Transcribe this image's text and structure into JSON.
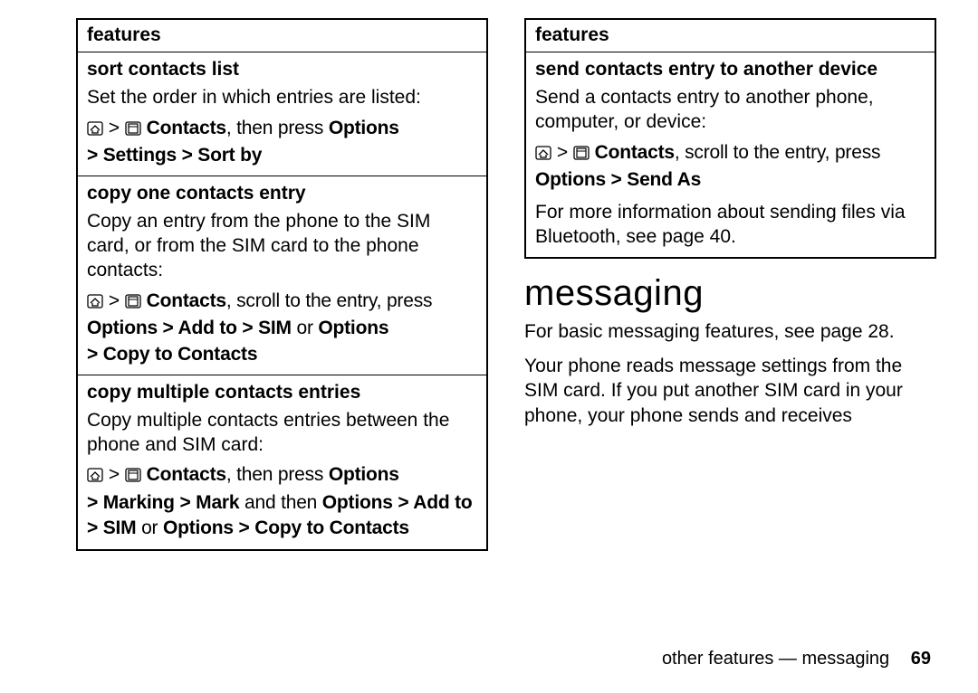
{
  "left": {
    "header": "features",
    "r1": {
      "title": "sort contacts list",
      "desc": "Set the order in which entries are listed:",
      "nav1_app": "Contacts",
      "nav1_mid": ", then press ",
      "nav1_opt": "Options",
      "nav2": "> Settings > Sort by"
    },
    "r2": {
      "title": "copy one contacts entry",
      "desc": "Copy an entry from the phone to the SIM card, or from the SIM card to the phone contacts:",
      "nav1_app": "Contacts",
      "nav1_mid": ", scroll to the entry, press ",
      "nav2a": "Options > Add to > SIM",
      "nav2_or": " or ",
      "nav2b": "Options",
      "nav3": "> Copy to Contacts"
    },
    "r3": {
      "title": "copy multiple contacts entries",
      "desc": "Copy multiple contacts entries between the phone and SIM card:",
      "nav1_app": "Contacts",
      "nav1_mid": ", then press ",
      "nav1_opt": "Options",
      "nav2a": "> Marking > Mark",
      "nav2_mid": " and then ",
      "nav2b": "Options > Add to",
      "nav3a": "> SIM",
      "nav3_or": " or ",
      "nav3b": "Options > Copy to Contacts"
    }
  },
  "right": {
    "header": "features",
    "r1": {
      "title": "send contacts entry to another device",
      "desc": "Send a contacts entry to another phone, computer, or device:",
      "nav1_app": "Contacts",
      "nav1_mid": ", scroll to the entry, press ",
      "nav2": "Options > Send As",
      "more": "For more information about sending files via Bluetooth, see page 40."
    },
    "section_heading": "messaging",
    "p1": "For basic messaging features, see page 28.",
    "p2": "Your phone reads message settings from the SIM card. If you put another SIM card in your phone, your phone sends and receives"
  },
  "footer": {
    "text": "other features — messaging",
    "page": "69"
  },
  "glyphs": {
    "gt": ">"
  }
}
